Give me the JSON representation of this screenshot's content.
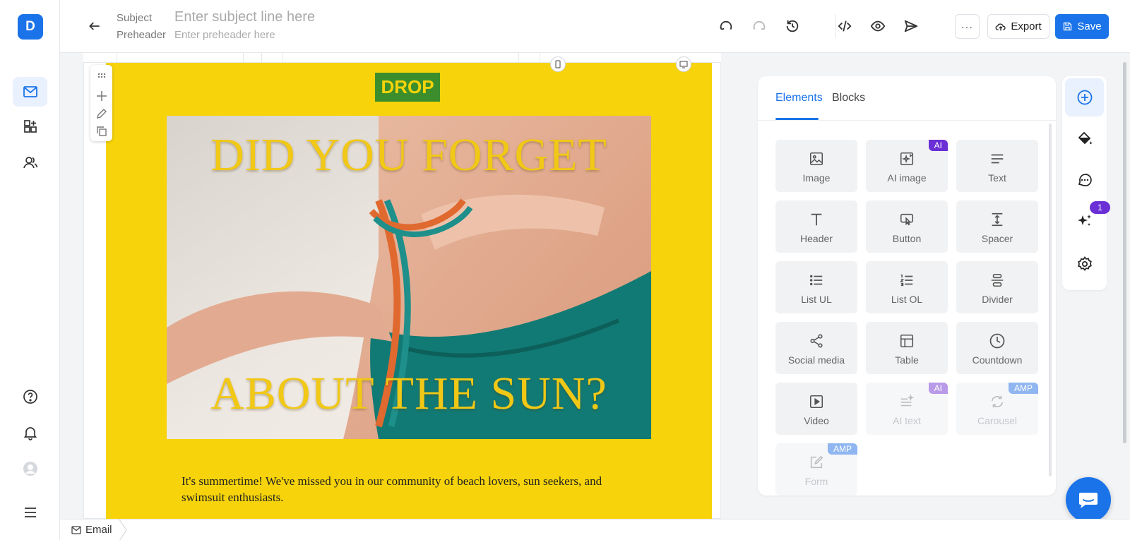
{
  "app": {
    "logo_letter": "D",
    "accent": "#1a73e8",
    "email_bg": "#f6d30a"
  },
  "leftnav": {
    "items": [
      {
        "name": "mail-icon",
        "active": true
      },
      {
        "name": "templates-icon",
        "active": false
      },
      {
        "name": "contacts-icon",
        "active": false
      }
    ],
    "bottom": [
      "help-icon",
      "bell-icon",
      "user-avatar",
      "menu-icon"
    ]
  },
  "header": {
    "subject_label": "Subject",
    "subject_placeholder": "Enter subject line here",
    "preheader_label": "Preheader",
    "preheader_placeholder": "Enter preheader here",
    "more_label": "···",
    "export_label": "Export",
    "save_label": "Save"
  },
  "email": {
    "logo_text": "DROP",
    "headline_top": "DID YOU FORGET",
    "headline_bottom": "ABOUT THE SUN?",
    "body": "It's summertime! We've missed you in our community of beach lovers, sun seekers, and swimsuit enthusiasts."
  },
  "panel": {
    "tabs": [
      {
        "label": "Elements",
        "active": true
      },
      {
        "label": "Blocks",
        "active": false
      }
    ],
    "elements": [
      {
        "label": "Image",
        "icon": "image-icon"
      },
      {
        "label": "AI image",
        "icon": "ai-image-icon",
        "badge": "AI"
      },
      {
        "label": "Text",
        "icon": "text-icon"
      },
      {
        "label": "Header",
        "icon": "header-icon"
      },
      {
        "label": "Button",
        "icon": "button-icon"
      },
      {
        "label": "Spacer",
        "icon": "spacer-icon"
      },
      {
        "label": "List UL",
        "icon": "list-ul-icon"
      },
      {
        "label": "List OL",
        "icon": "list-ol-icon"
      },
      {
        "label": "Divider",
        "icon": "divider-icon"
      },
      {
        "label": "Social media",
        "icon": "share-icon"
      },
      {
        "label": "Table",
        "icon": "table-icon"
      },
      {
        "label": "Countdown",
        "icon": "clock-icon"
      },
      {
        "label": "Video",
        "icon": "video-icon"
      },
      {
        "label": "AI text",
        "icon": "ai-text-icon",
        "badge": "AI",
        "disabled": true
      },
      {
        "label": "Carousel",
        "icon": "carousel-icon",
        "badge": "AMP",
        "disabled": true
      },
      {
        "label": "Form",
        "icon": "form-icon",
        "badge": "AMP",
        "disabled": true
      }
    ]
  },
  "rail": {
    "notification_count": "1"
  },
  "footer": {
    "crumb": "Email"
  }
}
